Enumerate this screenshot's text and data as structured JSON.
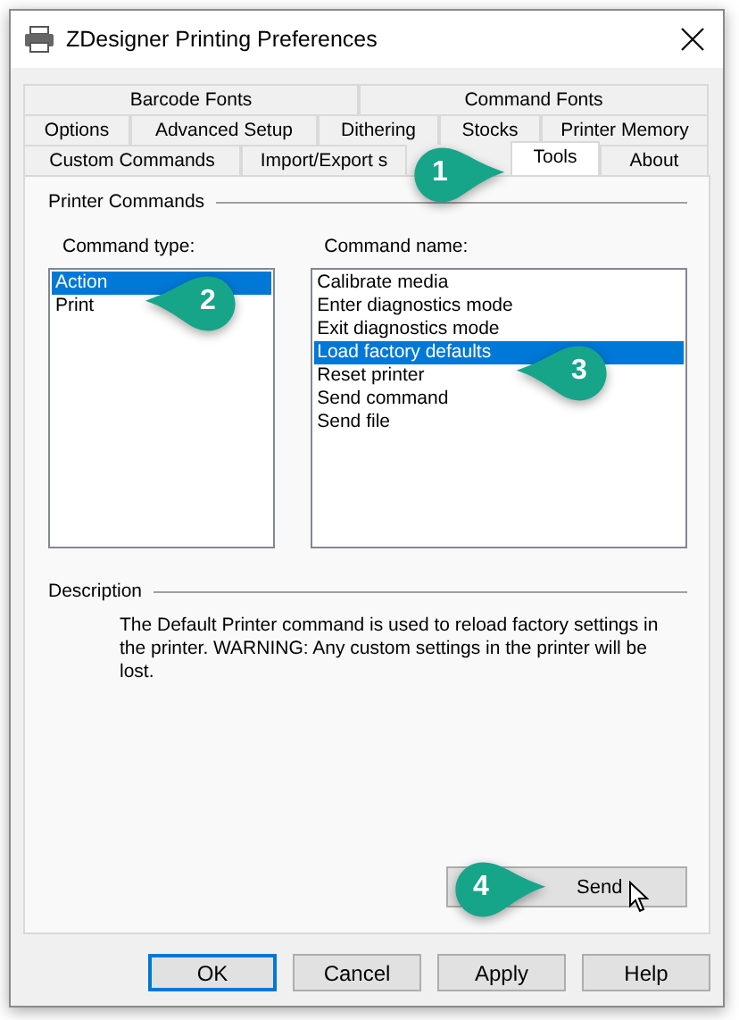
{
  "window": {
    "title": "ZDesigner Printing Preferences"
  },
  "tab_rows": [
    [
      {
        "label": "Barcode Fonts",
        "selected": false
      },
      {
        "label": "Command Fonts",
        "selected": false
      }
    ],
    [
      {
        "label": "Options",
        "selected": false
      },
      {
        "label": "Advanced Setup",
        "selected": false
      },
      {
        "label": "Dithering",
        "selected": false
      },
      {
        "label": "Stocks",
        "selected": false
      },
      {
        "label": "Printer Memory",
        "selected": false
      }
    ],
    [
      {
        "label": "Custom Commands",
        "selected": false
      },
      {
        "label": "Import/Export s",
        "selected": false
      },
      {
        "label": "Tools",
        "selected": true
      },
      {
        "label": "About",
        "selected": false
      }
    ]
  ],
  "printer_commands": {
    "title": "Printer Commands",
    "command_type": {
      "label": "Command type:",
      "items": [
        {
          "label": "Action",
          "selected": true
        },
        {
          "label": "Print",
          "selected": false
        }
      ]
    },
    "command_name": {
      "label": "Command name:",
      "items": [
        {
          "label": "Calibrate media",
          "selected": false
        },
        {
          "label": "Enter diagnostics mode",
          "selected": false
        },
        {
          "label": "Exit diagnostics mode",
          "selected": false
        },
        {
          "label": "Load factory defaults",
          "selected": true
        },
        {
          "label": "Reset printer",
          "selected": false
        },
        {
          "label": "Send command",
          "selected": false
        },
        {
          "label": "Send file",
          "selected": false
        }
      ]
    }
  },
  "description": {
    "title": "Description",
    "text": "The Default Printer command is used to reload factory settings in the printer. WARNING: Any custom settings in the printer will be lost."
  },
  "send_button": "Send",
  "buttons": [
    {
      "label": "OK",
      "default": true
    },
    {
      "label": "Cancel",
      "default": false
    },
    {
      "label": "Apply",
      "default": false
    },
    {
      "label": "Help",
      "default": false
    }
  ],
  "callouts": [
    {
      "number": "1"
    },
    {
      "number": "2"
    },
    {
      "number": "3"
    },
    {
      "number": "4"
    }
  ]
}
